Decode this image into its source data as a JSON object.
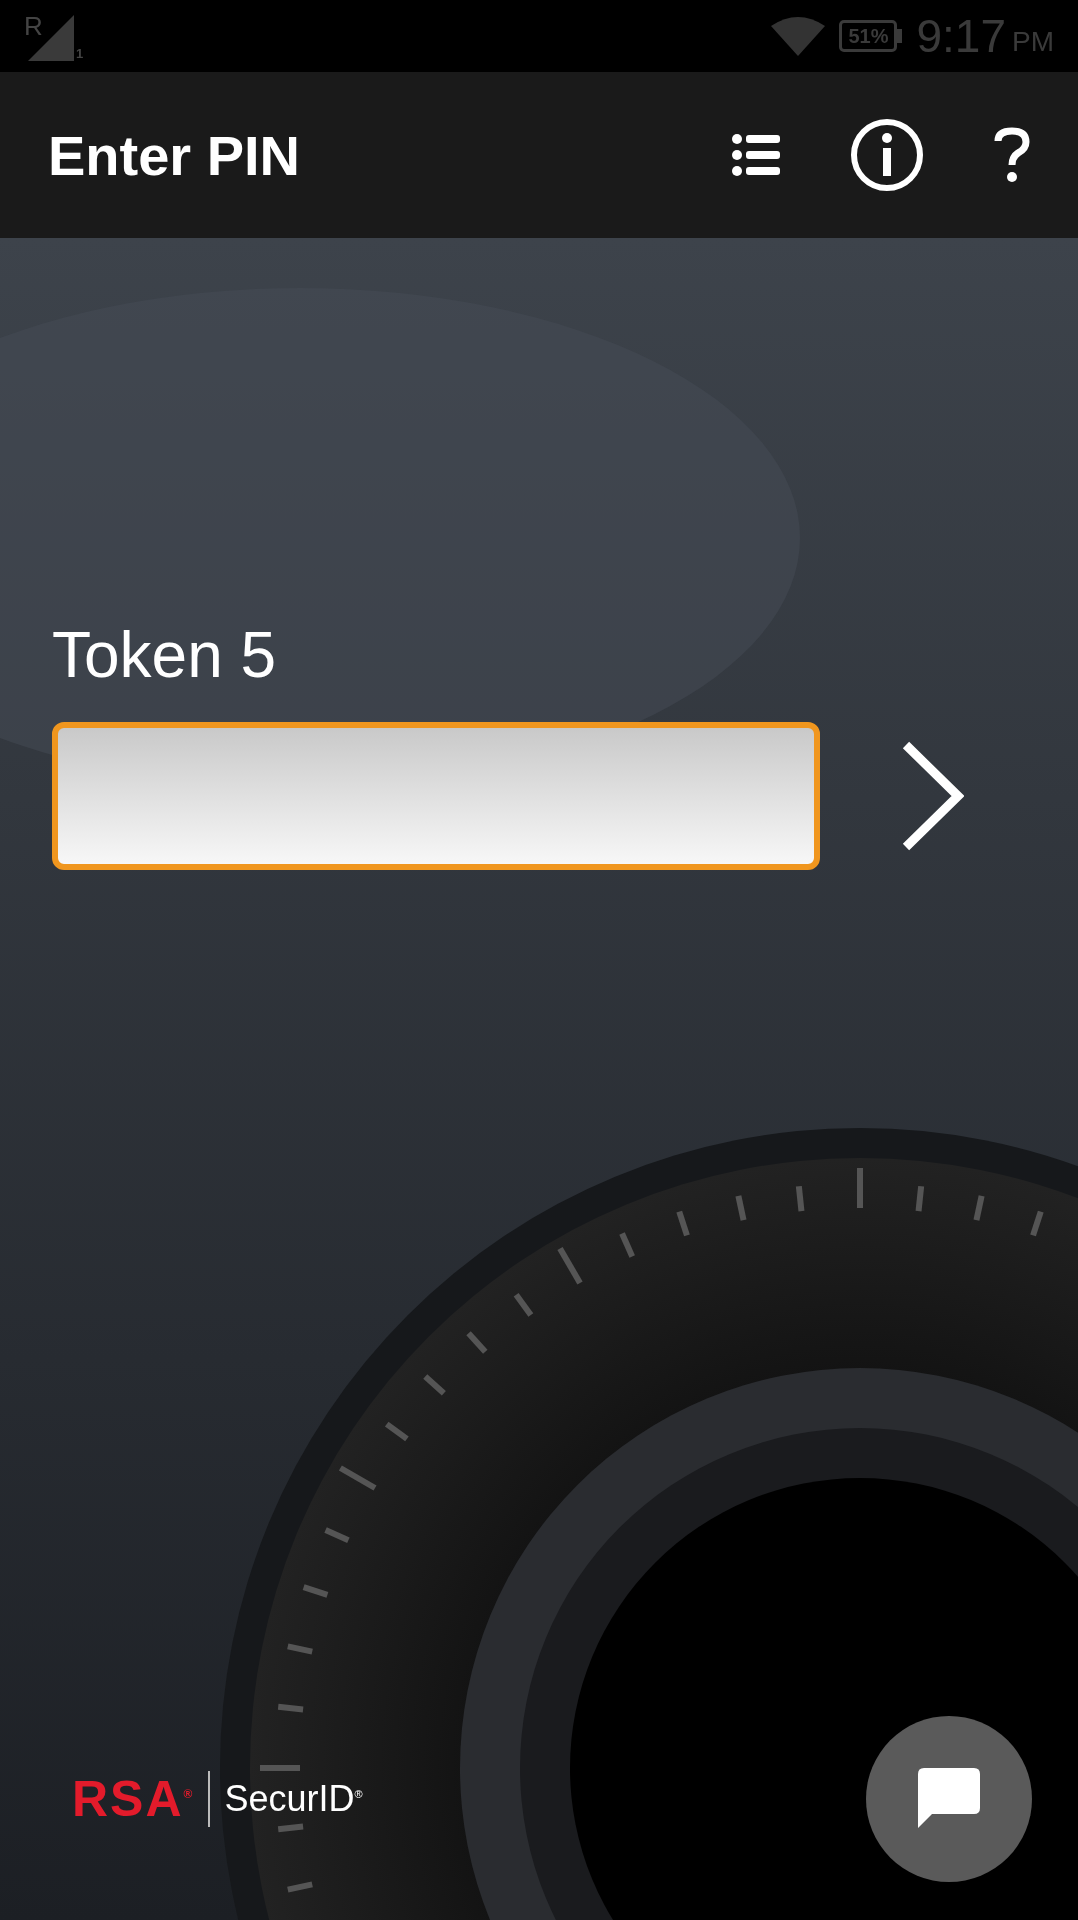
{
  "status_bar": {
    "network_label": "R",
    "sim": "1",
    "battery": "51%",
    "time": "9:17",
    "ampm": "PM"
  },
  "app_bar": {
    "title": "Enter PIN"
  },
  "token": {
    "label": "Token 5",
    "pin_field": {
      "focused": true
    }
  },
  "logo": {
    "brand": "RSA$^{®}$",
    "product": "SecurID$^{®}$"
  }
}
